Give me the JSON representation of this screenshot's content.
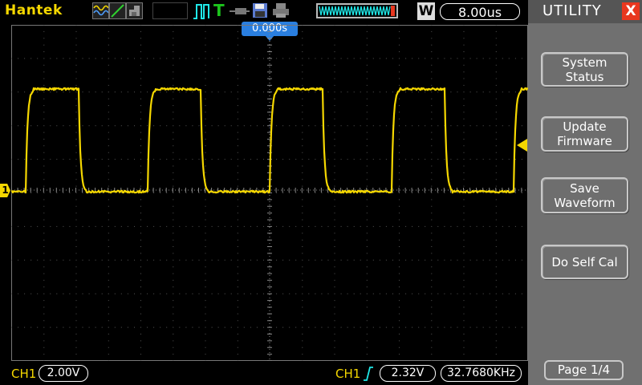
{
  "header": {
    "brand": "Hantek",
    "timebase": "8.00us",
    "waveform_mode_letter": "W",
    "icons": [
      "sine-wave-mode-icon",
      "ramp-mode-icon",
      "noise-mode-icon",
      "run-pulse-icon",
      "trigger-t-icon",
      "probe-icon",
      "save-icon",
      "print-icon",
      "memory-bar-icon"
    ]
  },
  "screen": {
    "trigger_position": "0.000s",
    "ch1_marker": "1",
    "trace_color": "#f5d700"
  },
  "footer": {
    "ch1_label": "CH1",
    "ch1_scale": "2.00V",
    "trigger_source": "CH1",
    "trigger_edge": "rising-edge-icon",
    "trigger_level": "2.32V",
    "frequency": "32.7680KHz"
  },
  "sidebar": {
    "title": "UTILITY",
    "close_label": "X",
    "buttons": [
      {
        "line1": "System",
        "line2": "Status"
      },
      {
        "line1": "Update",
        "line2": "Firmware"
      },
      {
        "line1": "Save",
        "line2": "Waveform"
      },
      {
        "line1": "Do Self Cal",
        "line2": ""
      }
    ],
    "page": "Page 1/4"
  },
  "colors": {
    "accent_yellow": "#f5d700",
    "trigger_blue": "#2a7fe0",
    "close_red": "#e8371f",
    "panel_gray": "#707070"
  }
}
